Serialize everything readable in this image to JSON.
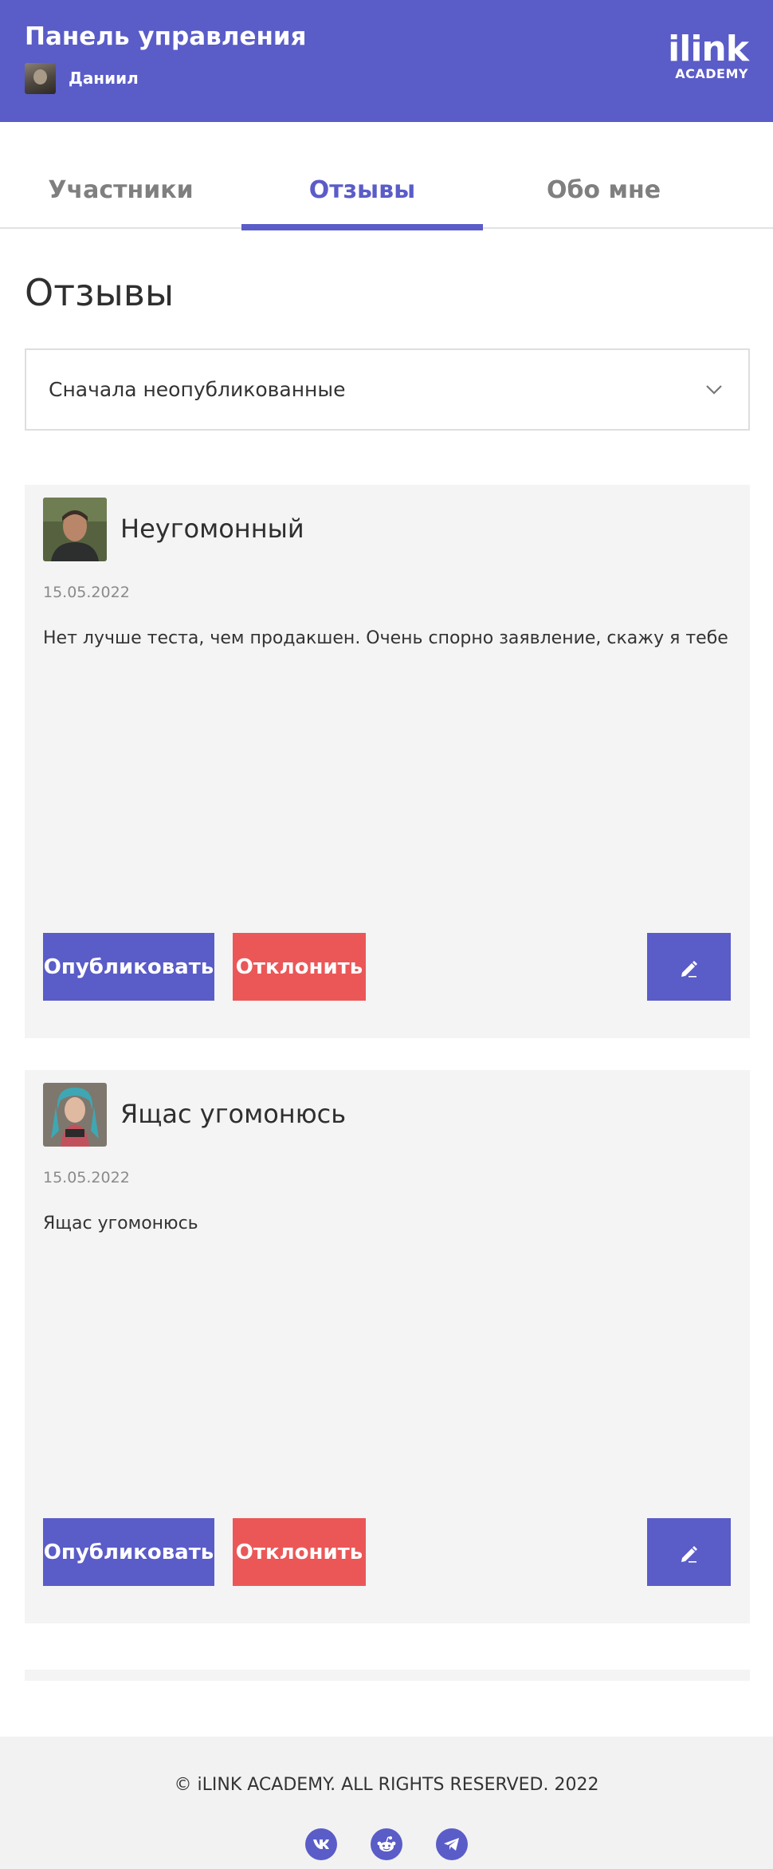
{
  "header": {
    "title": "Панель управления",
    "user_name": "Даниил",
    "logo_main": "ilink",
    "logo_sub": "ACADEMY"
  },
  "tabs": [
    {
      "label": "Участники",
      "active": false
    },
    {
      "label": "Отзывы",
      "active": true
    },
    {
      "label": "Обо мне",
      "active": false
    }
  ],
  "page_title": "Отзывы",
  "sort_select": {
    "value": "Сначала неопубликованные",
    "icon": "chevron-down-icon"
  },
  "reviews": [
    {
      "author": "Неугомонный",
      "date": "15.05.2022",
      "text": "Нет лучше теста, чем продакшен. Очень спорно заявление, скажу я тебе",
      "publish_label": "Опубликовать",
      "reject_label": "Отклонить",
      "edit_icon": "pencil-icon"
    },
    {
      "author": "Ящас угомонюсь",
      "date": "15.05.2022",
      "text": "Ящас угомонюсь",
      "publish_label": "Опубликовать",
      "reject_label": "Отклонить",
      "edit_icon": "pencil-icon"
    }
  ],
  "footer": {
    "copyright": "© iLINK ACADEMY. ALL RIGHTS RESERVED. 2022",
    "socials": [
      "vk-icon",
      "reddit-icon",
      "telegram-icon"
    ]
  },
  "colors": {
    "accent": "#5a5cc8",
    "danger": "#eb5757",
    "card_bg": "#f4f4f4"
  }
}
